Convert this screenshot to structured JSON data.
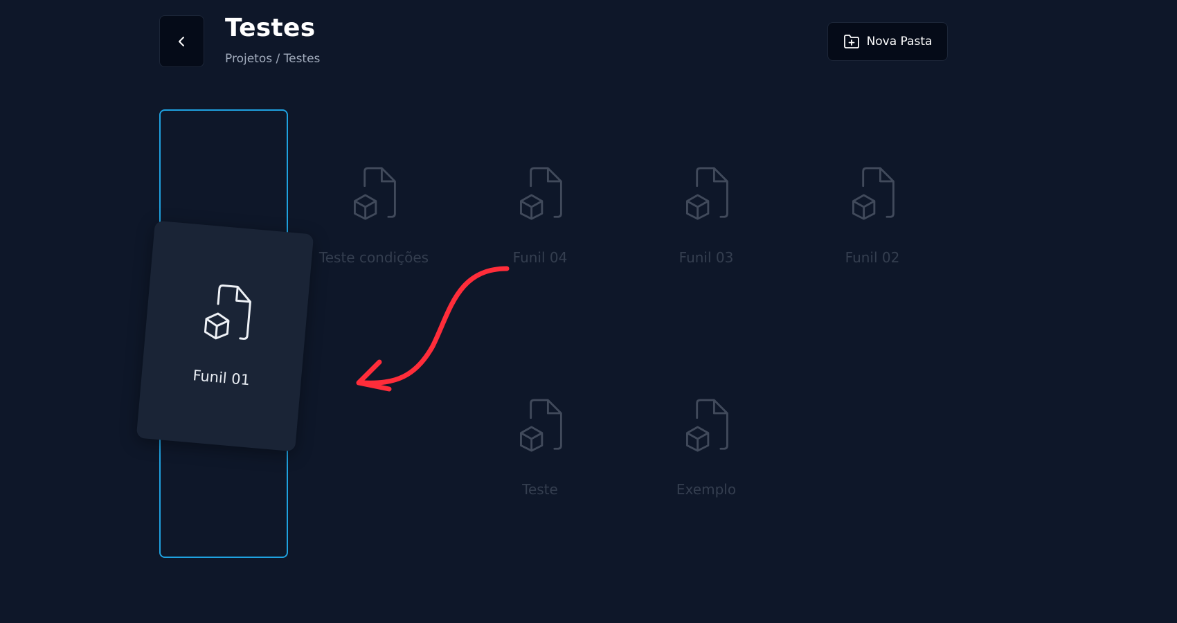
{
  "header": {
    "title": "Testes",
    "breadcrumb": "Projetos / Testes",
    "back_icon": "chevron-left-icon",
    "new_folder_label": "Nova Pasta",
    "new_folder_icon": "folder-plus-icon"
  },
  "cards": [
    {
      "label": "Teste condições",
      "icon": "file-box-icon"
    },
    {
      "label": "Funil 04",
      "icon": "file-box-icon"
    },
    {
      "label": "Funil 03",
      "icon": "file-box-icon"
    },
    {
      "label": "Funil 02",
      "icon": "file-box-icon"
    },
    {
      "label": "Teste",
      "icon": "file-box-icon"
    },
    {
      "label": "Exemplo",
      "icon": "file-box-icon"
    }
  ],
  "dragged_card": {
    "label": "Funil 01",
    "icon": "file-box-icon"
  },
  "colors": {
    "background": "#0e1729",
    "drop_highlight": "#1fa2e0",
    "annotation_arrow": "#ff2d3a"
  }
}
